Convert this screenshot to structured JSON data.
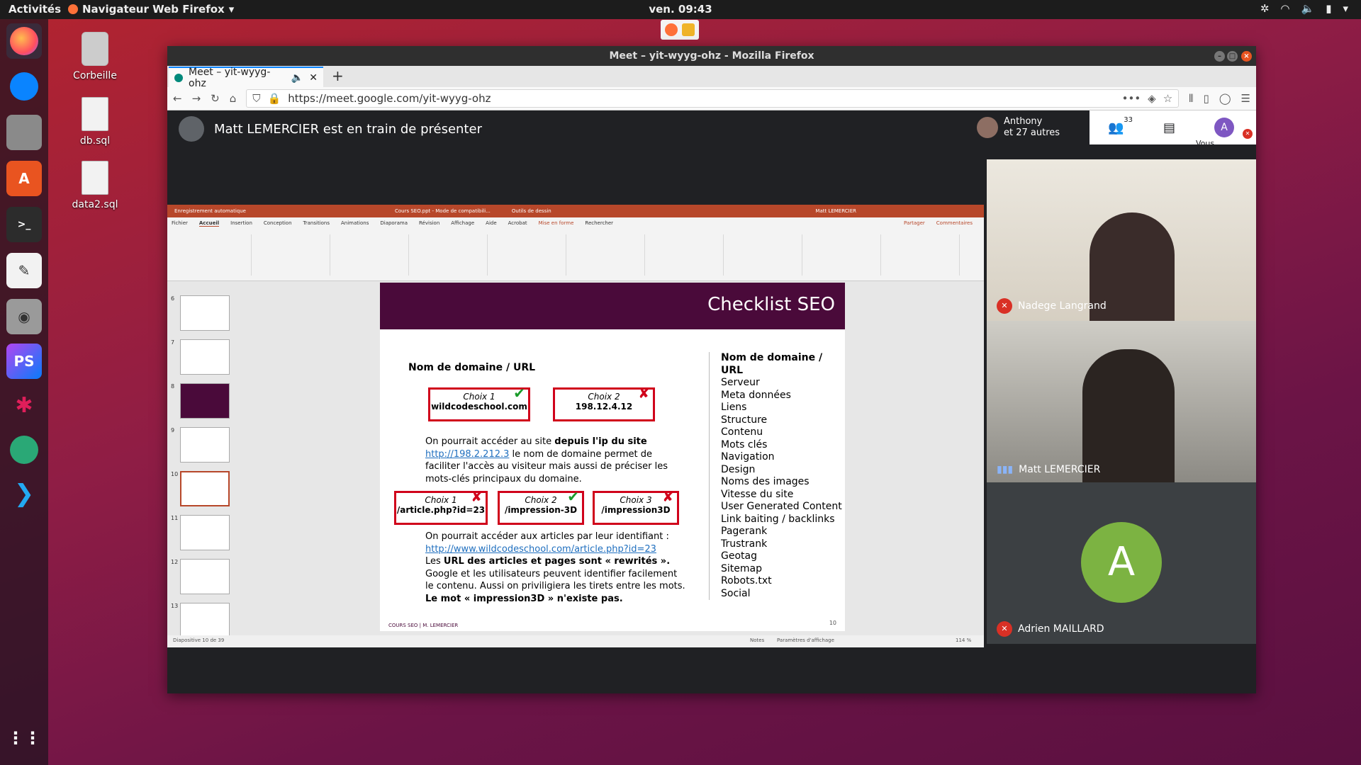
{
  "topbar": {
    "activities": "Activités",
    "app_name": "Navigateur Web Firefox",
    "clock": "ven. 09:43"
  },
  "desktop": {
    "icons": [
      {
        "label": "Corbeille"
      },
      {
        "label": "db.sql"
      },
      {
        "label": "data2.sql"
      }
    ]
  },
  "browser": {
    "window_title": "Meet – yit-wyyg-ohz - Mozilla Firefox",
    "tab_title": "Meet – yit-wyyg-ohz",
    "url": "https://meet.google.com/yit-wyyg-ohz",
    "new_tab": "+"
  },
  "meet": {
    "presenting_text": "Matt LEMERCIER est en train de présenter",
    "participants_name": "Anthony",
    "participants_others": "et 27 autres",
    "participant_count": "33",
    "you_label": "Vous",
    "you_avatar": "A",
    "tiles": [
      {
        "name": "Nadege Langrand",
        "muted": true
      },
      {
        "name": "Matt LEMERCIER",
        "muted": false
      },
      {
        "name": "Adrien MAILLARD",
        "muted": true,
        "avatar": "A"
      }
    ]
  },
  "powerpoint": {
    "autosave": "Enregistrement automatique",
    "file": "Cours SEO.ppt - Mode de compatibili...",
    "tools": "Outils de dessin",
    "user": "Matt LEMERCIER",
    "tabs": [
      "Fichier",
      "Accueil",
      "Insertion",
      "Conception",
      "Transitions",
      "Animations",
      "Diaporama",
      "Révision",
      "Affichage",
      "Aide",
      "Acrobat",
      "Mise en forme",
      "Rechercher"
    ],
    "share": "Partager",
    "comments": "Commentaires",
    "status_left": "Diapositive 10 de 39",
    "status_notes": "Notes",
    "status_display": "Paramètres d'affichage",
    "zoom": "114 %",
    "thumb_numbers": [
      "6",
      "7",
      "8",
      "9",
      "10",
      "11",
      "12",
      "13"
    ]
  },
  "slide": {
    "title": "Checklist SEO",
    "subtitle": "Nom de domaine / URL",
    "choice1_label": "Choix 1",
    "choice1_value": "wildcodeschool.com",
    "choice2_label": "Choix 2",
    "choice2_value": "198.12.4.12",
    "para1_a": "On pourrait accéder au site ",
    "para1_b": "depuis l'ip du site",
    "para1_link": "http://198.2.212.3",
    "para1_c": " le nom de domaine permet de faciliter l'accès au visiteur mais aussi de préciser les mots-clés principaux du domaine.",
    "c1_label": "Choix 1",
    "c1_value": "/article.php?id=23",
    "c2_label": "Choix 2",
    "c2_value": "/impression-3D",
    "c3_label": "Choix 3",
    "c3_value": "/impression3D",
    "para2_a": "On pourrait accéder aux articles par leur identifiant :",
    "para2_link": "http://www.wildcodeschool.com/article.php?id=23",
    "para2_b": "Les ",
    "para2_bold": "URL des articles et pages sont « rewrités ».",
    "para2_c": "Google et les utilisateurs peuvent identifier facilement le contenu. Aussi on priviligiera les tirets entre les mots.",
    "para2_last": "Le mot « impression3D » n'existe pas.",
    "footer": "COURS SEO | M. LEMERCIER",
    "page_num": "10",
    "right_title": "Nom de domaine / URL",
    "right_list": [
      "Serveur",
      "Meta données",
      "Liens",
      "Structure",
      "Contenu",
      "Mots clés",
      "Navigation",
      "Design",
      "Noms des images",
      "Vitesse du site",
      "User Generated Content",
      "Link baiting / backlinks",
      "Pagerank",
      "Trustrank",
      "Geotag",
      "Sitemap",
      "Robots.txt",
      "Social"
    ]
  },
  "colors": {
    "accent": "#0a84ff",
    "slide_header": "#4a0a3a",
    "red": "#d0021b",
    "green": "#1a9b2a",
    "ppt": "#b7472a"
  }
}
